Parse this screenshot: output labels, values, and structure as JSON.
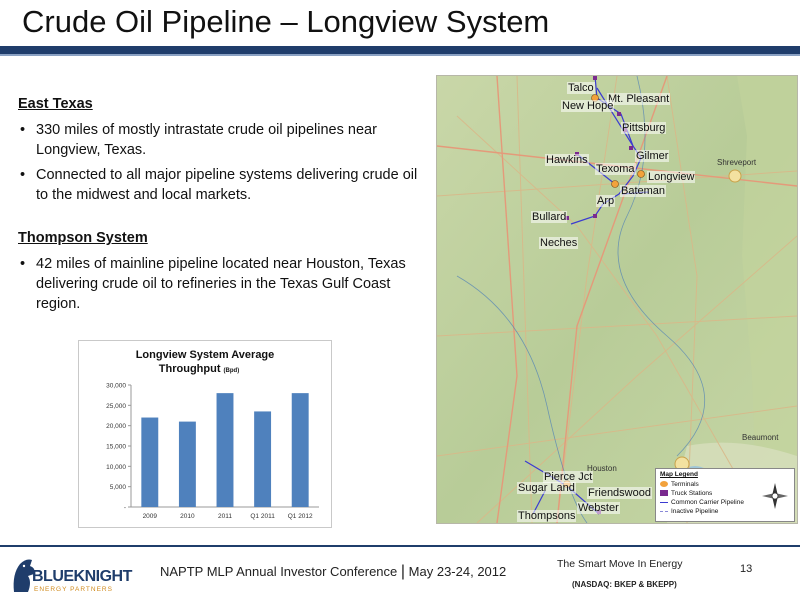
{
  "title": "Crude Oil Pipeline – Longview System",
  "sections": [
    {
      "heading": "East Texas",
      "bullets": [
        "330 miles of mostly intrastate crude oil pipelines near Longview, Texas.",
        "Connected to all major pipeline systems delivering crude oil to the midwest and local markets."
      ]
    },
    {
      "heading": "Thompson System",
      "bullets": [
        "42 miles of  mainline pipeline located near Houston, Texas delivering crude oil to refineries in the Texas Gulf Coast region."
      ]
    }
  ],
  "chart_data": {
    "type": "bar",
    "title_line1": "Longview System Average",
    "title_line2": "Throughput",
    "title_unit": "(Bpd)",
    "categories": [
      "2009",
      "2010",
      "2011",
      "Q1 2011",
      "Q1 2012"
    ],
    "values": [
      22000,
      21000,
      28000,
      23500,
      28000
    ],
    "ylim": [
      0,
      30000
    ],
    "yticks": [
      {
        "v": 0,
        "label": "-"
      },
      {
        "v": 5000,
        "label": "5,000"
      },
      {
        "v": 10000,
        "label": "10,000"
      },
      {
        "v": 15000,
        "label": "15,000"
      },
      {
        "v": 20000,
        "label": "20,000"
      },
      {
        "v": 25000,
        "label": "25,000"
      },
      {
        "v": 30000,
        "label": "30,000"
      }
    ],
    "bar_color": "#4f81bd",
    "grid": false
  },
  "map": {
    "labels": {
      "talco": "Talco",
      "mt_pleasant": "Mt. Pleasant",
      "new_hope": "New Hope",
      "pittsburg": "Pittsburg",
      "hawkins": "Hawkins",
      "gilmer": "Gilmer",
      "texoma": "Texoma",
      "longview": "Longview",
      "bateman": "Bateman",
      "arp": "Arp",
      "bullard": "Bullard",
      "neches": "Neches",
      "pierce_jct": "Pierce Jct",
      "sugar_land": "Sugar Land",
      "friendswood": "Friendswood",
      "thompsons": "Thompsons",
      "webster": "Webster"
    },
    "small_cities": {
      "shreveport": "Shreveport",
      "beaumont": "Beaumont",
      "houston": "Houston"
    },
    "legend": {
      "title": "Map Legend",
      "items": [
        "Terminals",
        "Truck Stations",
        "Common Carrier Pipeline",
        "Inactive Pipeline"
      ]
    },
    "colors": {
      "terminal": "#f2a23c",
      "truck_station": "#7a2a8f",
      "pipeline": "#3b3bd1",
      "inactive": "#8a8ad8"
    }
  },
  "footer": {
    "logo_name": "BLUEKNIGHT",
    "logo_sub": "ENERGY PARTNERS",
    "conference": "NAPTP MLP Annual Investor Conference",
    "date": "May 23-24, 2012",
    "tagline": "The Smart Move In Energy",
    "ticker": "(NASDAQ: BKEP & BKEPP)",
    "page": "13"
  }
}
